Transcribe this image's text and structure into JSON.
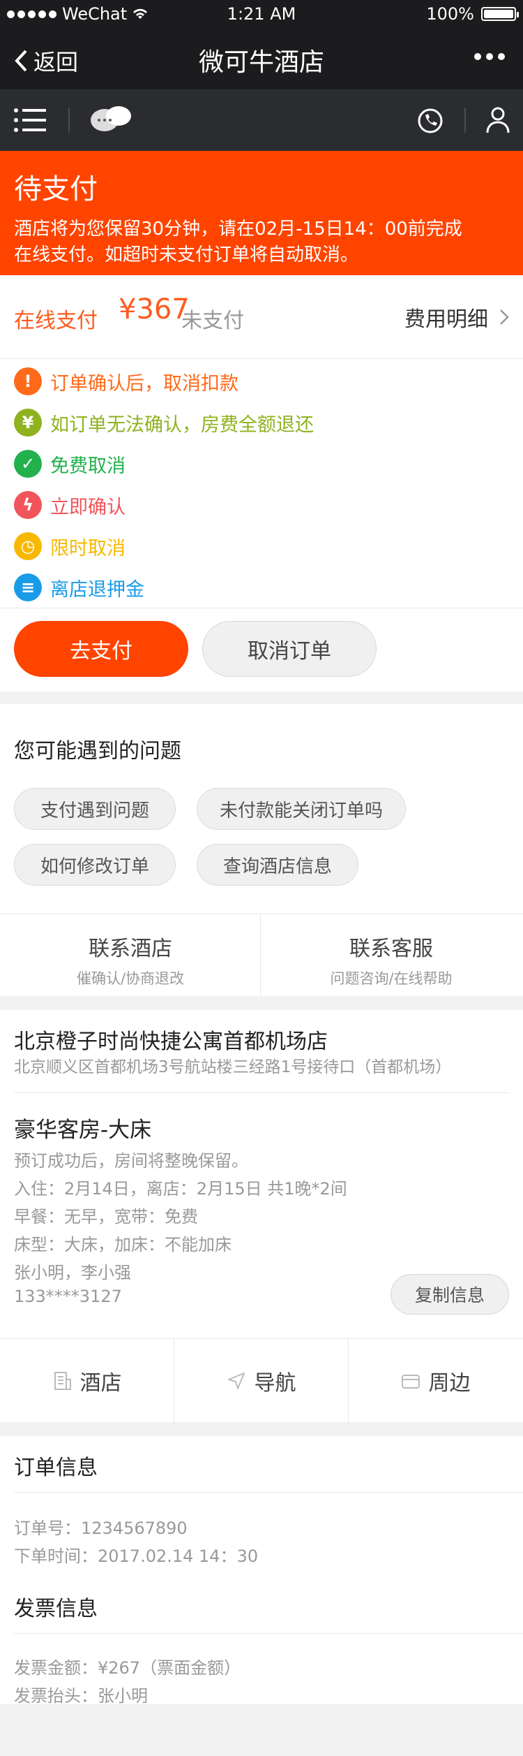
{
  "status_bar": {
    "carrier": "WeChat",
    "time": "1:21 AM",
    "battery": "100%"
  },
  "nav": {
    "back_label": "返回",
    "title": "微可牛酒店"
  },
  "toolbar": {
    "icons": [
      "menu-icon",
      "chat-icon",
      "phone-icon",
      "user-icon"
    ]
  },
  "banner": {
    "title": "待支付",
    "line1": "酒店将为您保留30分钟，请在02月-15日14：00前完成",
    "line2": "在线支付。如超时未支付订单将自动取消。"
  },
  "payment": {
    "label": "在线支付",
    "amount": "¥367",
    "status": "未支付",
    "fee_link": "费用明细"
  },
  "policies": [
    {
      "text": "订单确认后，取消扣款",
      "icon": "!",
      "icon_name": "alert-icon",
      "color": "#ff6a1a"
    },
    {
      "text": "如订单无法确认，房费全额退还",
      "icon": "¥",
      "icon_name": "yuan-icon",
      "color": "#8fb21f"
    },
    {
      "text": "免费取消",
      "icon": "✓",
      "icon_name": "check-icon",
      "color": "#22b14c"
    },
    {
      "text": "立即确认",
      "icon": "ϟ",
      "icon_name": "lightning-icon",
      "color": "#f2545b"
    },
    {
      "text": "限时取消",
      "icon": "◷",
      "icon_name": "clock-icon",
      "color": "#f7b800"
    },
    {
      "text": "离店退押金",
      "icon": "≡",
      "icon_name": "coins-icon",
      "color": "#1a9be8"
    }
  ],
  "buttons": {
    "pay": "去支付",
    "cancel": "取消订单"
  },
  "faq": {
    "title": "您可能遇到的问题",
    "chips": [
      "支付遇到问题",
      "未付款能关闭订单吗",
      "如何修改订单",
      "查询酒店信息"
    ]
  },
  "contact": {
    "hotel": {
      "title": "联系酒店",
      "sub": "催确认/协商退改"
    },
    "service": {
      "title": "联系客服",
      "sub": "问题咨询/在线帮助"
    }
  },
  "hotel": {
    "name": "北京橙子时尚快捷公寓首都机场店",
    "address": "北京顺义区首都机场3号航站楼三经路1号接待口（首都机场）",
    "room": "豪华客房-大床",
    "details": [
      "预订成功后，房间将整晚保留。",
      "入住：2月14日，离店：2月15日  共1晚*2间",
      "早餐：无早，宽带：免费",
      "床型：大床，加床：不能加床",
      "张小明，李小强",
      "133****3127"
    ],
    "copy_label": "复制信息"
  },
  "actions": [
    {
      "label": "酒店",
      "icon_name": "hotel-icon"
    },
    {
      "label": "导航",
      "icon_name": "navigation-icon"
    },
    {
      "label": "周边",
      "icon_name": "nearby-icon"
    }
  ],
  "order": {
    "title": "订单信息",
    "number": "订单号：1234567890",
    "time": "下单时间：2017.02.14 14：30"
  },
  "invoice": {
    "title": "发票信息",
    "amount": "发票金额：¥267（票面金额）",
    "header": "发票抬头：张小明"
  },
  "colors": {
    "accent": "#ff4400",
    "dark_bar": "#1c1c1e"
  }
}
